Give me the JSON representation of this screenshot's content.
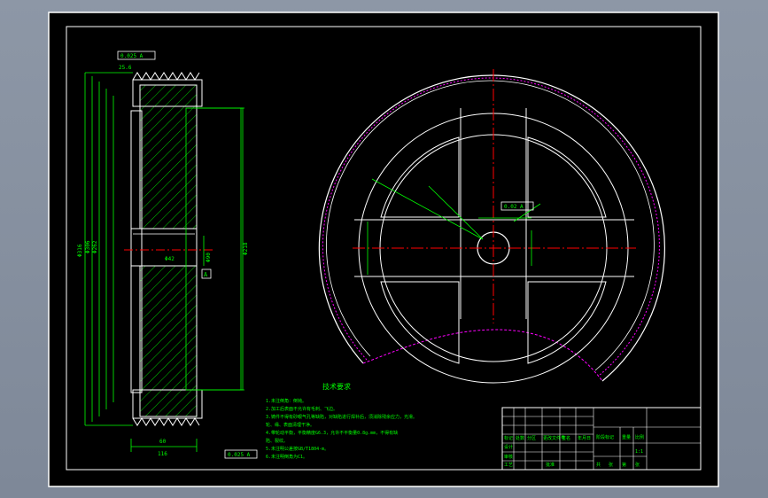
{
  "drawing": {
    "tech_req_title": "技术要求",
    "tech_req_lines": [
      "1.未注倒角：倒钝。",
      "2.加工后表面不允许有毛刺、飞边。",
      "3.铸件不得有砂眼气孔等缺陷，对缺陷进行焊补后，须消除残余应力，光滑。",
      "轮、缘、表面清理干净。",
      "4.带轮动平衡，平衡精度G6.3，允许不平衡量0.8g.mm，不得有缺",
      "陷、裂纹。",
      "5.未注明公差按GB/T1804-m。",
      "6.未注明倒角为C1。"
    ],
    "dims_left": [
      "Φ316",
      "Φ306",
      "Φ262",
      "Φ218",
      "Φ90",
      "Φ42",
      "116",
      "25.6",
      "60"
    ],
    "tolerance_frames": [
      "0.025 A",
      "0.025 A",
      "0.02 A"
    ],
    "datum_label": "A",
    "title_block": {
      "cells": [
        "标记",
        "处数",
        "分区",
        "更改文件号",
        "签名",
        "年月日",
        "阶段标记",
        "重量",
        "比例",
        "设计",
        "审核",
        "工艺",
        "批准",
        "共",
        "张",
        "第",
        "张",
        "1:1"
      ]
    },
    "colors": {
      "background": "#000000",
      "outline": "#ffffff",
      "dimension": "#00ff00",
      "centerline": "#ff0000",
      "hatch": "#00ff00",
      "pitch_circle": "#ff00ff",
      "frame": "#ffffff"
    }
  }
}
